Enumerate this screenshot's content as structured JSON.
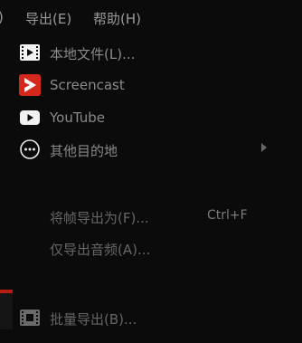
{
  "menubar": {
    "items": [
      {
        "label": ")"
      },
      {
        "label": "导出(E)"
      },
      {
        "label": "帮助(H)"
      }
    ]
  },
  "menu": {
    "items": [
      {
        "label": "本地文件(L)...",
        "icon": "film-icon"
      },
      {
        "label": "Screencast",
        "icon": "screencast-icon",
        "color": "#d4281c"
      },
      {
        "label": "YouTube",
        "icon": "youtube-icon"
      },
      {
        "label": "其他目的地",
        "icon": "more-icon"
      },
      {
        "label": "将帧导出为(F)...",
        "shortcut": "Ctrl+F"
      },
      {
        "label": "仅导出音频(A)..."
      },
      {
        "label": "批量导出(B)...",
        "icon": "batch-film-icon"
      }
    ]
  }
}
